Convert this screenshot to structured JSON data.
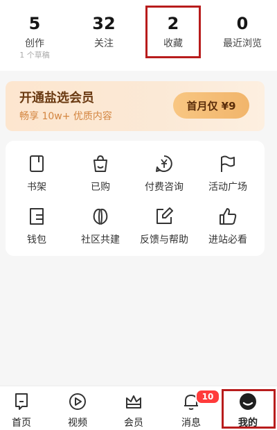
{
  "stats": [
    {
      "num": "5",
      "label": "创作",
      "sub": "1 个草稿"
    },
    {
      "num": "32",
      "label": "关注"
    },
    {
      "num": "2",
      "label": "收藏"
    },
    {
      "num": "0",
      "label": "最近浏览"
    }
  ],
  "member": {
    "title": "开通盐选会员",
    "desc": "畅享 10w+ 优质内容",
    "button": "首月仅 ¥9"
  },
  "grid": [
    {
      "label": "书架",
      "icon": "bookshelf-icon"
    },
    {
      "label": "已购",
      "icon": "shopping-bag-icon"
    },
    {
      "label": "付费咨询",
      "icon": "yen-chat-icon"
    },
    {
      "label": "活动广场",
      "icon": "flag-icon"
    },
    {
      "label": "钱包",
      "icon": "wallet-icon"
    },
    {
      "label": "社区共建",
      "icon": "leaves-icon"
    },
    {
      "label": "反馈与帮助",
      "icon": "edit-icon"
    },
    {
      "label": "进站必看",
      "icon": "thumbs-up-icon"
    }
  ],
  "tabs": [
    {
      "label": "首页",
      "icon": "home-icon"
    },
    {
      "label": "视频",
      "icon": "play-icon"
    },
    {
      "label": "会员",
      "icon": "crown-icon"
    },
    {
      "label": "消息",
      "icon": "bell-icon",
      "badge": "10"
    },
    {
      "label": "我的",
      "icon": "profile-icon",
      "active": true
    }
  ],
  "colors": {
    "highlight": "#b81c1c",
    "member_bg": "#fde6cf",
    "member_button": "#f1b56b",
    "badge": "#ff3b3b"
  }
}
